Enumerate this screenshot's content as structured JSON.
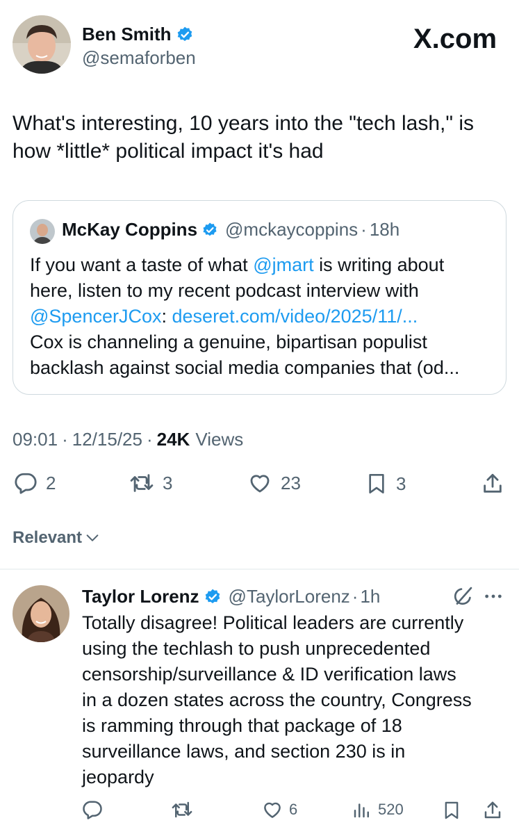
{
  "main_post": {
    "author_name": "Ben Smith",
    "author_handle": "@semaforben",
    "brand": "X.com",
    "text": "What's interesting, 10 years into the \"tech lash,\" is how *little* political impact it's had",
    "meta": {
      "time": "09:01",
      "date": "12/15/25",
      "views_count": "24K",
      "views_label": "Views",
      "sep": "·"
    },
    "actions": {
      "replies": "2",
      "reposts": "3",
      "likes": "23",
      "bookmarks": "3"
    }
  },
  "quoted_post": {
    "author_name": "McKay Coppins",
    "author_handle": "@mckaycoppins",
    "time": "18h",
    "sep": "·",
    "line1_a": "If you want a taste of what ",
    "line1_mention": "@jmart",
    "line1_b": " is writing about",
    "line2": "here, listen to my recent podcast interview with",
    "line3_mention": "@SpencerJCox",
    "line3_colon": ": ",
    "line3_link": "deseret.com/video/2025/11/...",
    "line4": "Cox is channeling a genuine, bipartisan populist",
    "line5": "backlash against social media companies that (od..."
  },
  "sort": {
    "label": "Relevant"
  },
  "reply": {
    "author_name": "Taylor Lorenz",
    "author_handle": "@TaylorLorenz",
    "time": "1h",
    "sep": "·",
    "lines": [
      "Totally disagree! Political leaders are currently",
      "using the techlash to push unprecedented",
      "censorship/surveillance & ID verification laws",
      "in a dozen states across the country, Congress",
      "is ramming through that package of 18",
      "surveillance laws, and section 230 is in",
      "jeopardy"
    ],
    "actions": {
      "likes": "6",
      "views": "520"
    }
  },
  "colors": {
    "verified": "#1d9bf0",
    "link": "#1d9bf0",
    "secondary": "#536471",
    "divider": "#eff3f4"
  }
}
